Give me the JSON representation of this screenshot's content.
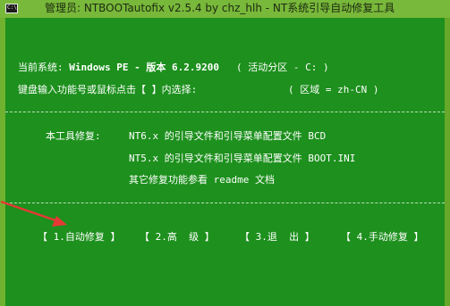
{
  "window": {
    "title": "管理员:  NTBOOTautofix v2.5.4 by chz_hlh - NT系统引导自动修复工具",
    "icon_text": "C:\\"
  },
  "console": {
    "system_label": "当前系统:",
    "system_value": "Windows PE - 版本 6.2.9200",
    "partition_label": "( 活动分区 - C: )",
    "prompt_label": "键盘输入功能号或鼠标点击【 】内选择:",
    "region_label": "( 区域 = zh-CN )",
    "divider_text": "--------------------------------------------------------------------------------------------------",
    "repair_label": "本工具修复:",
    "repair_lines": [
      "NT6.x 的引导文件和引导菜单配置文件 BCD",
      "NT5.x 的引导文件和引导菜单配置文件 BOOT.INI",
      "其它修复功能参看 readme 文档"
    ],
    "menu": [
      {
        "label": "【 1.自动修复 】"
      },
      {
        "label": "【 2.高  级 】"
      },
      {
        "label": "【 3.退  出 】"
      },
      {
        "label": "【 4.手动修复 】"
      }
    ]
  },
  "colors": {
    "console_background": "#1d901d",
    "frame_background": "#6fb22f",
    "text": "#ffffff",
    "annotation_arrow": "#e53935"
  }
}
